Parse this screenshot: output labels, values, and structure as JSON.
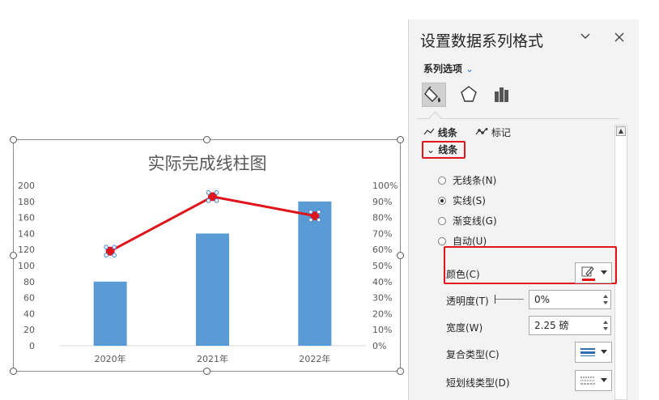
{
  "chart": {
    "title": "实际完成线柱图"
  },
  "chart_data": {
    "type": "bar",
    "title": "实际完成线柱图",
    "categories": [
      "2020年",
      "2021年",
      "2022年"
    ],
    "series": [
      {
        "kind": "bar",
        "axis": "primary",
        "values": [
          80,
          140,
          180
        ],
        "color": "#5b9bd5"
      },
      {
        "kind": "line",
        "axis": "secondary",
        "values": [
          0.59,
          0.93,
          0.81
        ],
        "color": "#e0141b"
      }
    ],
    "yticks": [
      "0",
      "20",
      "40",
      "60",
      "80",
      "100",
      "120",
      "140",
      "160",
      "180",
      "200"
    ],
    "ylim": [
      0,
      200
    ],
    "y2ticks": [
      "0%",
      "10%",
      "20%",
      "30%",
      "40%",
      "50%",
      "60%",
      "70%",
      "80%",
      "90%",
      "100%"
    ],
    "y2lim": [
      0,
      1
    ],
    "grid": false,
    "legend": "none"
  },
  "pane": {
    "title": "设置数据系列格式",
    "collapse_icon": "chevron-down-icon",
    "close_icon": "close-icon",
    "series_options": "系列选项",
    "tabs": [
      {
        "icon": "fill-line-icon",
        "active": true
      },
      {
        "icon": "effects-pentagon-icon",
        "active": false
      },
      {
        "icon": "series-options-bars-icon",
        "active": false
      }
    ],
    "subtabs": {
      "line": "线条",
      "marker": "标记"
    },
    "section": "线条",
    "radios": [
      {
        "label": "无线条(N)",
        "checked": false
      },
      {
        "label": "实线(S)",
        "checked": true
      },
      {
        "label": "渐变线(G)",
        "checked": false
      },
      {
        "label": "自动(U)",
        "checked": false
      }
    ],
    "color_label": "颜色(C)",
    "transparency_label": "透明度(T)",
    "transparency_value": "0%",
    "width_label": "宽度(W)",
    "width_value": "2.25 磅",
    "compound_label": "复合类型(C)",
    "dash_label": "短划线类型(D)",
    "accent_color": "#e0141b"
  }
}
